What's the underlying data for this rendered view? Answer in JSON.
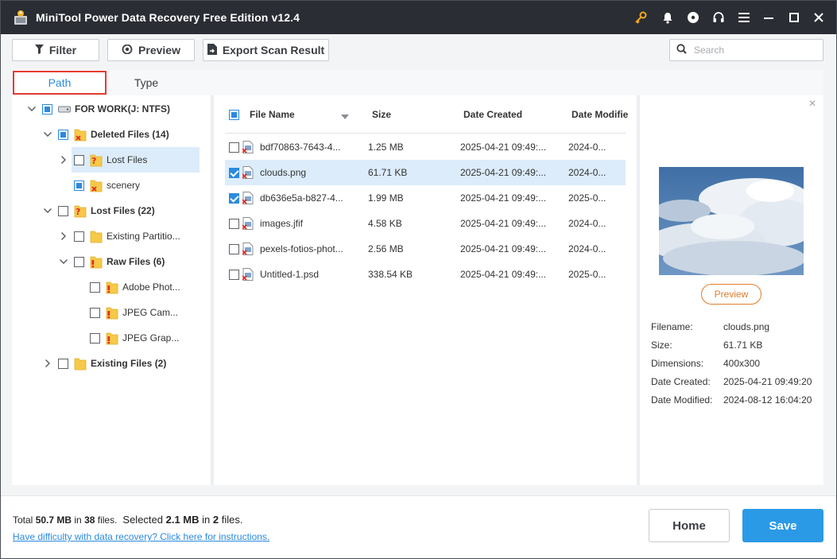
{
  "app": {
    "title": "MiniTool Power Data Recovery Free Edition v12.4"
  },
  "titlebar_icons": [
    "key-icon",
    "bell-icon",
    "disc-icon",
    "headset-icon",
    "menu-icon",
    "minimize-icon",
    "maximize-icon",
    "close-icon"
  ],
  "toolbar": {
    "filter_label": "Filter",
    "preview_label": "Preview",
    "export_label": "Export Scan Result",
    "search_placeholder": "Search"
  },
  "tabs": {
    "path": "Path",
    "type": "Type",
    "active": "Path"
  },
  "tree": [
    {
      "label": "FOR WORK(J: NTFS)",
      "level": 0,
      "expanded": true,
      "check": "partial",
      "icon": "drive-icon",
      "bold": true
    },
    {
      "label": "Deleted Files (14)",
      "level": 1,
      "expanded": true,
      "check": "partial",
      "icon": "deleted-folder-icon",
      "bold": true
    },
    {
      "label": "Lost Files",
      "level": 2,
      "expanded": false,
      "check": "none",
      "icon": "lost-folder-icon",
      "bold": false
    },
    {
      "label": "scenery",
      "level": 2,
      "expanded": null,
      "check": "partial",
      "icon": "deleted-folder-icon",
      "bold": false,
      "selected": true
    },
    {
      "label": "Lost Files (22)",
      "level": 1,
      "expanded": true,
      "check": "none",
      "icon": "lost-folder-icon",
      "bold": true
    },
    {
      "label": "Existing Partitio...",
      "level": 2,
      "expanded": false,
      "check": "none",
      "icon": "folder-icon",
      "bold": false
    },
    {
      "label": "Raw Files (6)",
      "level": 2,
      "expanded": true,
      "check": "none",
      "icon": "raw-folder-icon",
      "bold": true
    },
    {
      "label": "Adobe Phot...",
      "level": 3,
      "expanded": null,
      "check": "none",
      "icon": "raw-folder-icon",
      "bold": false
    },
    {
      "label": "JPEG Cam...",
      "level": 3,
      "expanded": null,
      "check": "none",
      "icon": "raw-folder-icon",
      "bold": false
    },
    {
      "label": "JPEG Grap...",
      "level": 3,
      "expanded": null,
      "check": "none",
      "icon": "raw-folder-icon",
      "bold": false
    },
    {
      "label": "Existing Files (2)",
      "level": 1,
      "expanded": false,
      "check": "none",
      "icon": "folder-icon",
      "bold": true
    }
  ],
  "file_list": {
    "columns": [
      "File Name",
      "Size",
      "Date Created",
      "Date Modifie"
    ],
    "rows": [
      {
        "name": "bdf70863-7643-4...",
        "size": "1.25 MB",
        "created": "2025-04-21 09:49:...",
        "modified": "2024-0...",
        "checked": false,
        "selected": false
      },
      {
        "name": "clouds.png",
        "size": "61.71 KB",
        "created": "2025-04-21 09:49:...",
        "modified": "2024-0...",
        "checked": true,
        "selected": true
      },
      {
        "name": "db636e5a-b827-4...",
        "size": "1.99 MB",
        "created": "2025-04-21 09:49:...",
        "modified": "2025-0...",
        "checked": true,
        "selected": false
      },
      {
        "name": "images.jfif",
        "size": "4.58 KB",
        "created": "2025-04-21 09:49:...",
        "modified": "2024-0...",
        "checked": false,
        "selected": false
      },
      {
        "name": "pexels-fotios-phot...",
        "size": "2.56 MB",
        "created": "2025-04-21 09:49:...",
        "modified": "2024-0...",
        "checked": false,
        "selected": false
      },
      {
        "name": "Untitled-1.psd",
        "size": "338.54 KB",
        "created": "2025-04-21 09:49:...",
        "modified": "2025-0...",
        "checked": false,
        "selected": false
      }
    ]
  },
  "preview": {
    "button_label": "Preview",
    "fields": [
      {
        "label": "Filename:",
        "value": "clouds.png"
      },
      {
        "label": "Size:",
        "value": "61.71 KB"
      },
      {
        "label": "Dimensions:",
        "value": "400x300"
      },
      {
        "label": "Date Created:",
        "value": "2025-04-21 09:49:20"
      },
      {
        "label": "Date Modified:",
        "value": "2024-08-12 16:04:20"
      }
    ]
  },
  "footer": {
    "total_prefix": "Total ",
    "total_size": "50.7 MB",
    "total_mid": " in ",
    "total_count": "38",
    "total_suffix": " files.",
    "selected_prefix": "Selected ",
    "selected_size": "2.1 MB",
    "selected_mid": " in ",
    "selected_count": "2",
    "selected_suffix": " files.",
    "help_link": "Have difficulty with data recovery? Click here for instructions.",
    "home_label": "Home",
    "save_label": "Save"
  },
  "colors": {
    "accent": "#2b8ae0",
    "save": "#2b9ae6",
    "highlight_border": "#e63b30",
    "preview_button": "#e07d2c",
    "titlebar": "#2a2d33",
    "selection": "#dcecfb"
  }
}
